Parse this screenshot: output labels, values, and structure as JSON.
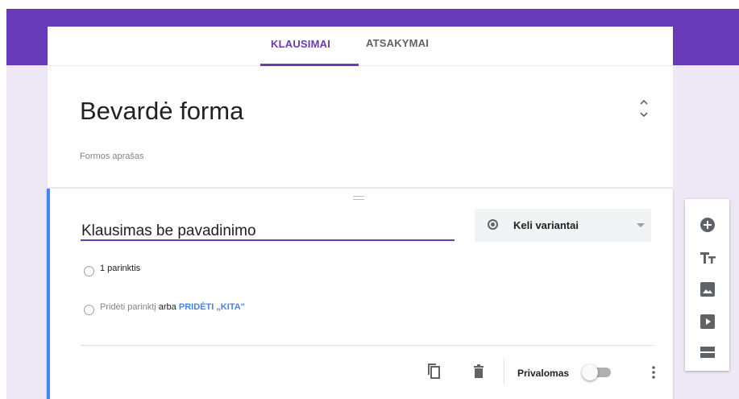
{
  "tabs": [
    {
      "label": "KLAUSIMAI",
      "active": true
    },
    {
      "label": "ATSAKYMAI",
      "active": false
    }
  ],
  "form": {
    "title": "Bevardė forma",
    "description_placeholder": "Formos aprašas"
  },
  "question": {
    "title": "Klausimas be pavadinimo",
    "type": {
      "label": "Keli variantai",
      "icon": "radio-button-icon"
    },
    "options": [
      {
        "label": "1 parinktis"
      }
    ],
    "add_option": {
      "text": "Pridėti parinktį",
      "or": "arba",
      "other_link": "PRIDĖTI „KITA\""
    },
    "footer": {
      "copy_icon": "copy-icon",
      "delete_icon": "delete-icon",
      "required_label": "Privalomas",
      "required_on": false,
      "more_icon": "more-vert-icon"
    }
  },
  "side_toolbar": [
    "add-question-icon",
    "add-title-icon",
    "add-image-icon",
    "add-video-icon",
    "add-section-icon"
  ],
  "colors": {
    "theme": "#673ab7",
    "background": "#ede7f6",
    "accent_blue": "#4285f4"
  }
}
